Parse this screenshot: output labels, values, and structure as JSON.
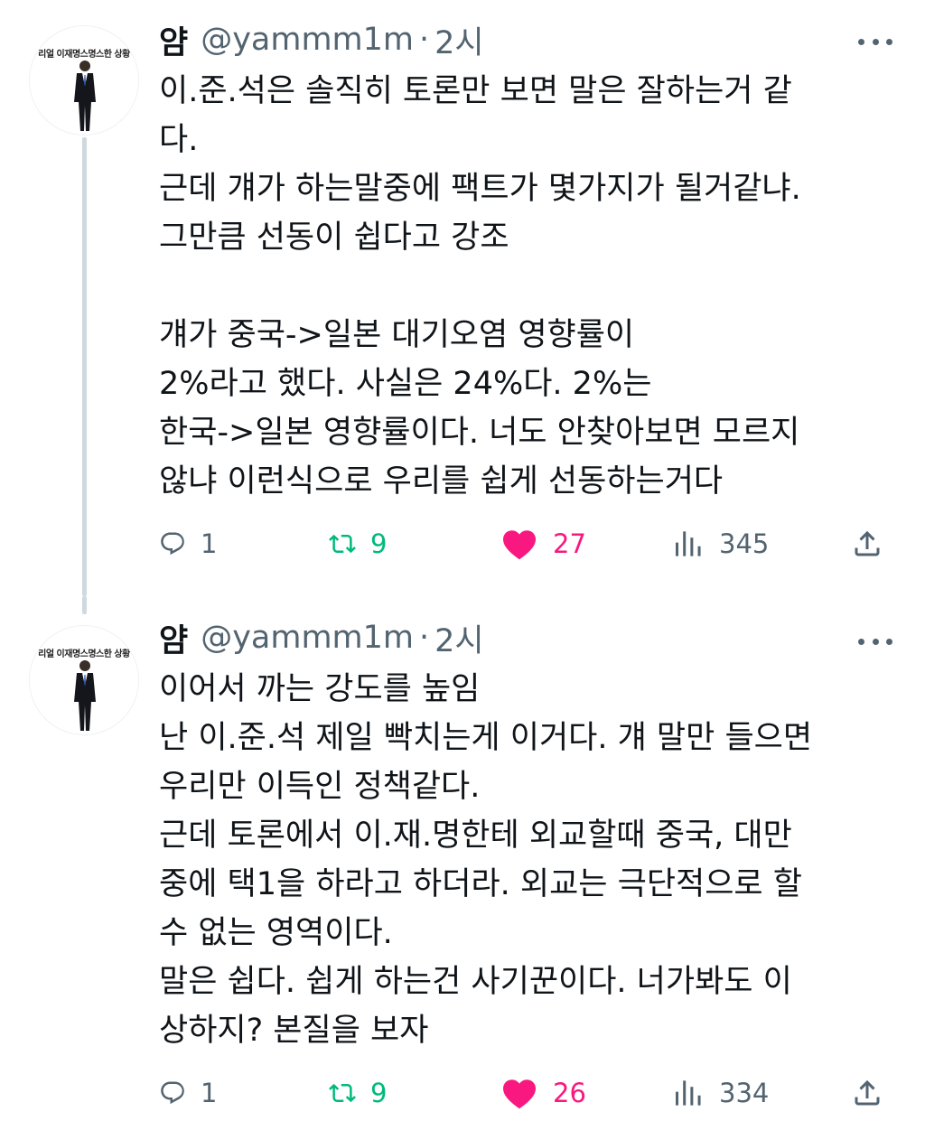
{
  "tweets": [
    {
      "display_name": "얌",
      "handle": "@yammm1m",
      "separator": "·",
      "time": "2시",
      "avatar_caption": "리얼 이재명스명스한 상황",
      "lines": [
        "이.준.석은 솔직히 토론만 보면 말은 잘하는거 같",
        "다.",
        "근데 걔가 하는말중에 팩트가 몇가지가 될거같냐.",
        "그만큼 선동이 쉽다고 강조",
        "",
        "걔가 중국->일본 대기오염 영향률이",
        "2%라고 했다. 사실은 24%다. 2%는",
        "한국->일본 영향률이다. 너도 안찾아보면 모르지",
        "않냐 이런식으로 우리를 쉽게 선동하는거다"
      ],
      "replies": "1",
      "retweets": "9",
      "likes": "27",
      "views": "345"
    },
    {
      "display_name": "얌",
      "handle": "@yammm1m",
      "separator": "·",
      "time": "2시",
      "avatar_caption": "리얼 이재명스명스한 상황",
      "lines": [
        "이어서 까는 강도를 높임",
        "난 이.준.석 제일 빡치는게 이거다. 걔 말만 들으면",
        "우리만 이득인 정책같다.",
        "근데 토론에서 이.재.명한테 외교할때 중국, 대만",
        "중에 택1을 하라고 하더라. 외교는 극단적으로 할",
        "수 없는 영역이다.",
        "말은 쉽다. 쉽게 하는건 사기꾼이다. 너가봐도 이",
        "상하지? 본질을 보자"
      ],
      "replies": "1",
      "retweets": "9",
      "likes": "26",
      "views": "334"
    }
  ],
  "icons": {
    "reply": "reply-icon",
    "retweet": "retweet-icon",
    "like": "heart-icon",
    "views": "views-icon",
    "share": "share-icon",
    "more": "more-icon"
  },
  "colors": {
    "text": "#0f1419",
    "secondary": "#536471",
    "retweet": "#00ba7c",
    "like": "#f91880",
    "thread_line": "#cfd9de"
  }
}
